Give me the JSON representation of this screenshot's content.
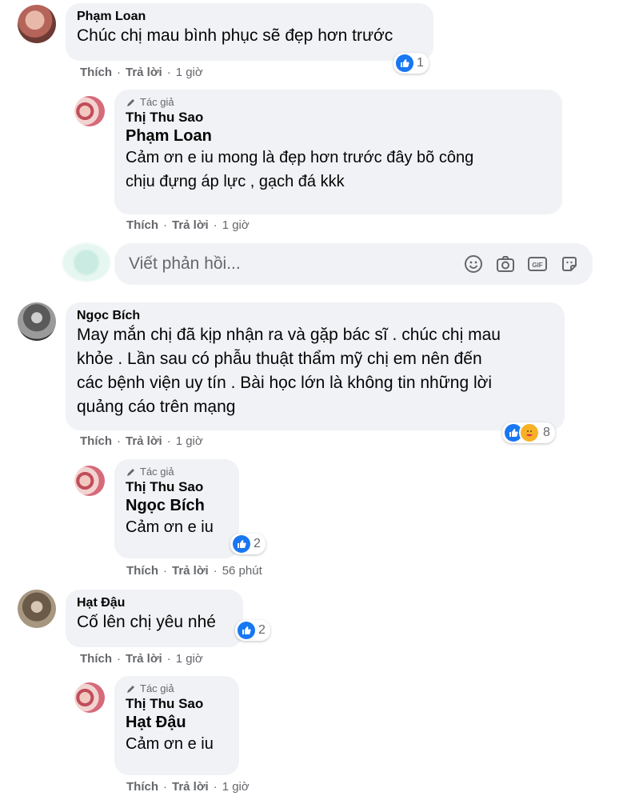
{
  "comments": [
    {
      "author": "Phạm Loan",
      "text": "Chúc chị mau bình phục sẽ đẹp hơn trước",
      "reactions": "1",
      "like": "Thích",
      "reply": "Trả lời",
      "time": "1 giờ",
      "sep": "·",
      "response": {
        "tag": "Tác giả",
        "author": "Thị Thu Sao",
        "to": "Phạm Loan",
        "text_line1": "Cảm ơn e iu mong là đẹp hơn trước đây bõ công",
        "text_line2": "chịu đựng áp lực , gạch đá kkk",
        "like": "Thích",
        "reply": "Trả lời",
        "time": "1 giờ"
      }
    },
    {
      "author": "Ngọc Bích",
      "text_line1": "May mắn chị đã kịp nhận ra và gặp bác sĩ . chúc chị mau",
      "text_line2": "khỏe . Lần sau có phẫu thuật thẩm mỹ chị em nên đến",
      "text_line3": "các bệnh viện uy tín . Bài học lớn là không tin những lời",
      "text_line4": "quảng cáo trên mạng",
      "reactions": "8",
      "like": "Thích",
      "reply": "Trả lời",
      "time": "1 giờ",
      "response": {
        "tag": "Tác giả",
        "author": "Thị Thu Sao",
        "to": "Ngọc Bích",
        "text": "Cảm ơn e iu",
        "reactions": "2",
        "like": "Thích",
        "reply": "Trả lời",
        "time": "56 phút"
      }
    },
    {
      "author": "Hạt Đậu",
      "text": "Cố lên chị yêu nhé",
      "reactions": "2",
      "like": "Thích",
      "reply": "Trả lời",
      "time": "1 giờ",
      "response": {
        "tag": "Tác giả",
        "author": "Thị Thu Sao",
        "to": "Hạt Đậu",
        "text": "Cảm ơn e iu",
        "like": "Thích",
        "reply": "Trả lời",
        "time": "1 giờ"
      }
    }
  ],
  "reply_input": {
    "placeholder": "Viết phản hồi...",
    "icons": [
      "emoji-icon",
      "camera-icon",
      "gif-icon",
      "sticker-icon"
    ]
  },
  "colors": {
    "bubble": "#f0f2f5",
    "secondary_text": "#65676b",
    "like_blue": "#1877f2"
  }
}
